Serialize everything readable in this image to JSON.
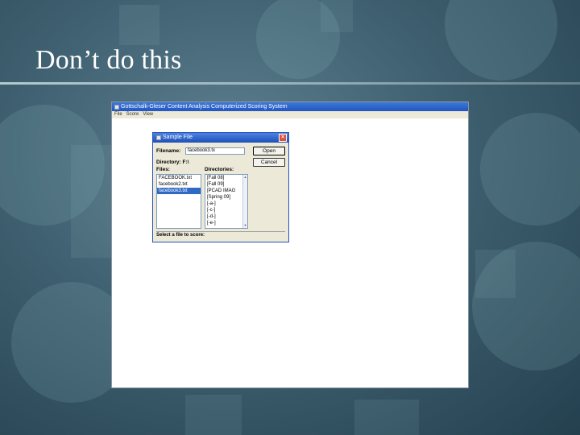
{
  "slide": {
    "title": "Don’t do this"
  },
  "app": {
    "window_title": "Gottschalk-Gleser Content Analysis Computerized Scoring System",
    "menu": [
      "File",
      "Score",
      "View"
    ]
  },
  "dialog": {
    "title": "Sample File",
    "close_glyph": "×",
    "filename_label": "Filename:",
    "filename_value": "facebook3.tx",
    "directory_label": "Directory: F:\\",
    "files_label": "Files:",
    "directories_label": "Directories:",
    "open_label": "Open",
    "cancel_label": "Cancel",
    "files": [
      "FACEBOOK.txt",
      "facebook2.txt",
      "facebook3.txt"
    ],
    "selected_file": "facebook3.txt",
    "directories": [
      "[Fall 08]",
      "[Fall 09]",
      "[PCAD IMAG",
      "[Spring 09]",
      "[-a-]",
      "[-c-]",
      "[-d-]",
      "[-e-]"
    ],
    "status": "Select a file to score:",
    "scroll_up": "▲",
    "scroll_down": "▼"
  },
  "colors": {
    "selection": "#316ac5",
    "titlebar": "#2255c0"
  }
}
